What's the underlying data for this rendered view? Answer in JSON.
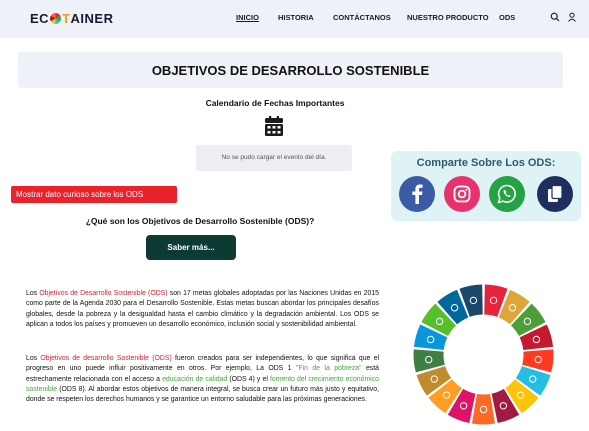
{
  "header": {
    "logo": {
      "part1": "EC",
      "part2": "T",
      "part3": "AINER"
    },
    "nav": [
      {
        "label": "INICIO",
        "active": true
      },
      {
        "label": "HISTORIA",
        "active": false
      },
      {
        "label": "CONTÁCTANOS",
        "active": false
      },
      {
        "label": "NUESTRO PRODUCTO",
        "active": false
      },
      {
        "label": "ODS",
        "active": false
      }
    ],
    "icons": [
      "search-icon",
      "user-icon"
    ]
  },
  "main": {
    "title": "OBJETIVOS DE DESARROLLO SOSTENIBLE",
    "calendar_title": "Calendario de Fechas Importantes",
    "calendar_icon": "calendar-icon",
    "event_message": "No se pudo cargar el evento del día.",
    "curious_button": "Mostrar dato curioso sobre los ODS",
    "question": "¿Qué son los Objetivos de Desarrollo Sostenible (ODS)?",
    "more_button": "Saber más..."
  },
  "share": {
    "title": "Comparte Sobre Los ODS:",
    "items": [
      {
        "name": "facebook-icon",
        "color": "#3b5ba5"
      },
      {
        "name": "instagram-icon",
        "color": "#e8326d"
      },
      {
        "name": "whatsapp-icon",
        "color": "#25a244"
      },
      {
        "name": "copy-icon",
        "color": "#1e2f5e"
      }
    ]
  },
  "paragraph1": {
    "t1": "Los ",
    "h1": "Objetivos de Desarrollo Sostenible (ODS)",
    "t2": " son 17 metas globales adoptadas por las Naciones Unidas en 2015 como parte de la Agenda 2030 para el Desarrollo Sostenible. Estas metas buscan abordar los principales desafíos globales, desde la pobreza y la desigualdad hasta el cambio climático y la degradación ambiental. Los ODS se aplican a todos los países y promueven un desarrollo económico, inclusión social y sostenibilidad ambiental."
  },
  "paragraph2": {
    "t1": "Los ",
    "h1": "Objetivos de desarrollo Sostenible (ODS)",
    "t2": " fueron creados para ser independientes, lo que significa que el progreso en uno puede influir positivamente en otros. Por ejemplo, La ODS 1 ",
    "h2": "\"Fin de la pobreza\"",
    "t3": " está estrechamente relacionada con el acceso a ",
    "h3": "educación de calidad",
    "t4": " (ODS 4) y el ",
    "h4": "fomento del crecimiento económico sostenible",
    "t5": " (ODS 8). Al abordar estos objetivos de manera integral, se busca crear un futuro más justo y equitativo, donde se respeten los derechos humanos y se garantice un entorno saludable para las próximas generaciones."
  },
  "sdg_wheel": {
    "segment_count": 17,
    "colors": [
      "#e5243b",
      "#dda63a",
      "#4c9f38",
      "#c5192d",
      "#ff3a21",
      "#26bde2",
      "#fcc30b",
      "#a21942",
      "#fd6925",
      "#dd1367",
      "#fd9d24",
      "#bf8b2e",
      "#3f7e44",
      "#0a97d9",
      "#56c02b",
      "#00689d",
      "#19486a"
    ]
  }
}
